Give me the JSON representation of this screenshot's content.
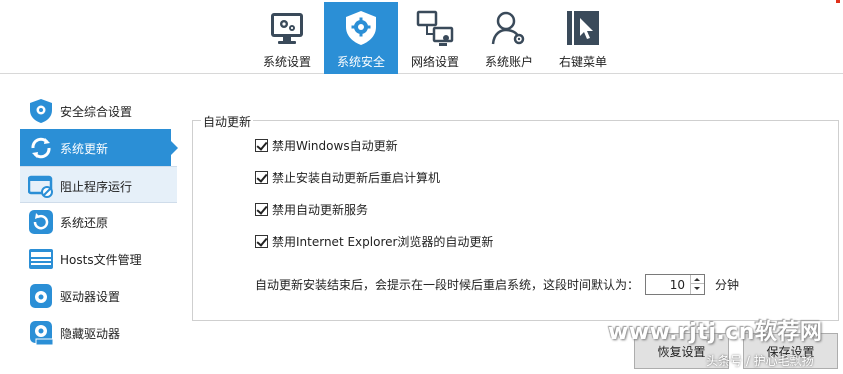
{
  "top_tabs": [
    {
      "label": "系统设置",
      "icon": "system-settings-icon"
    },
    {
      "label": "系统安全",
      "icon": "shield-gear-icon"
    },
    {
      "label": "网络设置",
      "icon": "network-icon"
    },
    {
      "label": "系统账户",
      "icon": "user-account-icon"
    },
    {
      "label": "右键菜单",
      "icon": "cursor-menu-icon"
    }
  ],
  "active_tab": "系统安全",
  "sidebar": {
    "items": [
      {
        "label": "安全综合设置",
        "icon": "shield-icon"
      },
      {
        "label": "系统更新",
        "icon": "refresh-icon"
      },
      {
        "label": "阻止程序运行",
        "icon": "block-window-icon"
      },
      {
        "label": "系统还原",
        "icon": "restore-icon"
      },
      {
        "label": "Hosts文件管理",
        "icon": "hosts-icon"
      },
      {
        "label": "驱动器设置",
        "icon": "drive-icon"
      },
      {
        "label": "隐藏驱动器",
        "icon": "hide-drive-icon"
      }
    ],
    "active": "系统更新"
  },
  "auto_update": {
    "title": "自动更新",
    "options": [
      {
        "label": "禁用Windows自动更新",
        "checked": true
      },
      {
        "label": "禁止安装自动更新后重启计算机",
        "checked": true
      },
      {
        "label": "禁用自动更新服务",
        "checked": true
      },
      {
        "label": "禁用Internet Explorer浏览器的自动更新",
        "checked": true
      }
    ],
    "delay_text": "自动更新安装结束后，会提示在一段时候后重启系统，这段时间默认为：",
    "delay_value": "10",
    "delay_unit": "分钟"
  },
  "buttons": {
    "restore": "恢复设置",
    "save": "保存设置"
  },
  "watermark": {
    "site": "www.rjtj.cn软荐网",
    "sub": "头条号 / 护心毛飘扬"
  },
  "colors": {
    "accent": "#2b8fd6",
    "icon_dark": "#3a4a5a"
  }
}
